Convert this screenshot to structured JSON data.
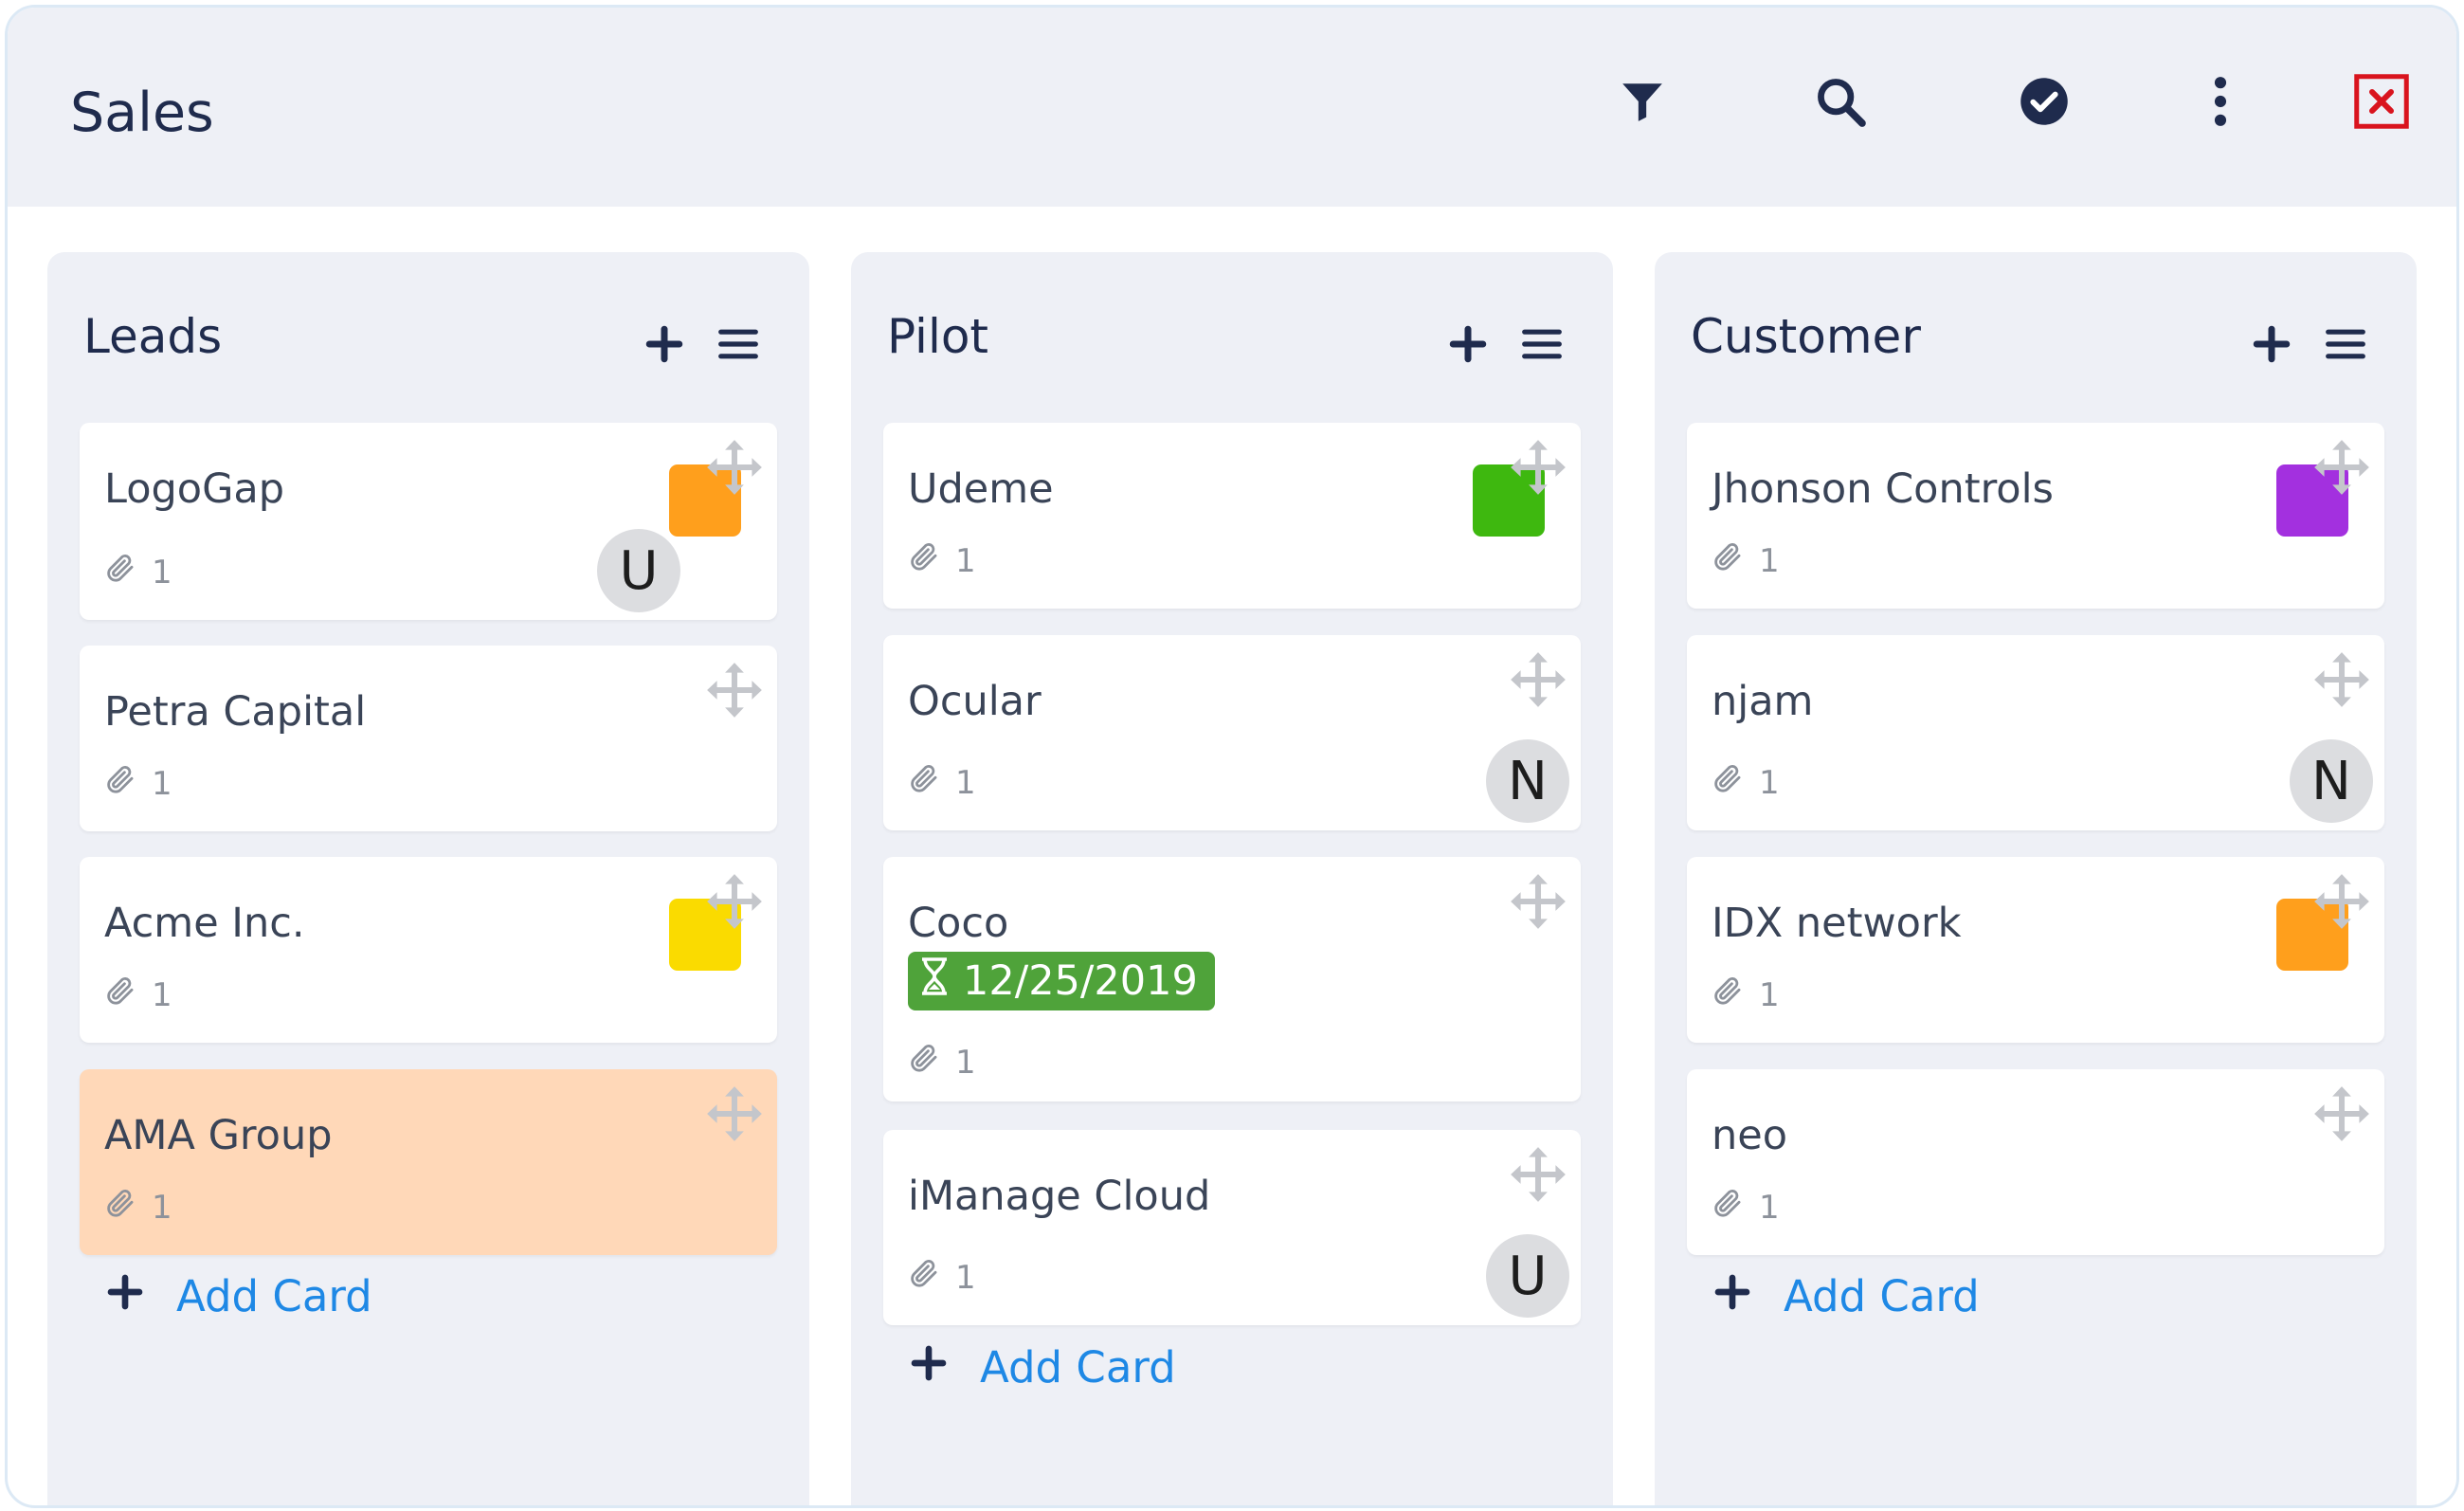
{
  "app": {
    "title": "Sales"
  },
  "toolbar": {
    "icons": [
      "filter-icon",
      "search-icon",
      "check-circle-icon",
      "more-vertical-icon",
      "close-icon"
    ]
  },
  "colors": {
    "label_orange": "#ff9f1c",
    "label_green": "#3eb80f",
    "label_purple": "#a330df",
    "label_yellow": "#fadb00",
    "date_badge": "#4fa33a",
    "link_blue": "#1e88e5",
    "ama_highlight": "#ffd8b8"
  },
  "columns": [
    {
      "title": "Leads",
      "add_card_label": "Add Card",
      "cards": [
        {
          "title": "LogoGap",
          "attachments": "1",
          "label_color": "orange",
          "avatar": "U"
        },
        {
          "title": "Petra Capital",
          "attachments": "1"
        },
        {
          "title": "Acme Inc.",
          "attachments": "1",
          "label_color": "yellow"
        },
        {
          "title": "AMA Group",
          "attachments": "1",
          "highlighted": true
        }
      ]
    },
    {
      "title": "Pilot",
      "add_card_label": "Add Card",
      "cards": [
        {
          "title": "Udeme",
          "attachments": "1",
          "label_color": "green"
        },
        {
          "title": "Ocular",
          "attachments": "1",
          "avatar": "N"
        },
        {
          "title": "Coco",
          "attachments": "1",
          "due_date": "12/25/2019"
        },
        {
          "title": "iManage Cloud",
          "attachments": "1",
          "avatar": "U"
        }
      ]
    },
    {
      "title": "Customer",
      "add_card_label": "Add Card",
      "cards": [
        {
          "title": "Jhonson Controls",
          "attachments": "1",
          "label_color": "purple"
        },
        {
          "title": "njam",
          "attachments": "1",
          "avatar": "N"
        },
        {
          "title": "IDX network",
          "attachments": "1",
          "label_color": "orange"
        },
        {
          "title": "neo",
          "attachments": "1"
        }
      ]
    }
  ]
}
